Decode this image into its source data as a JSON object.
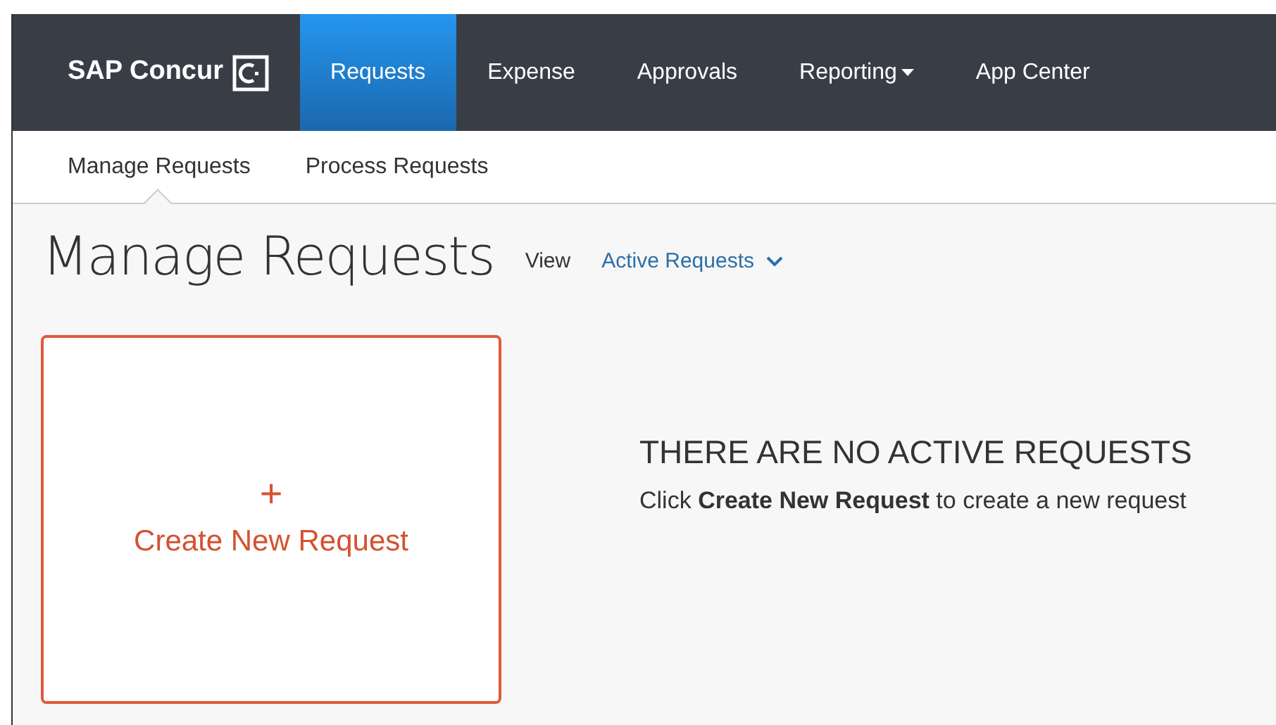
{
  "brand": {
    "name": "SAP Concur"
  },
  "nav": {
    "items": [
      {
        "label": "Requests",
        "selected": true,
        "has_menu": false
      },
      {
        "label": "Expense",
        "selected": false,
        "has_menu": false
      },
      {
        "label": "Approvals",
        "selected": false,
        "has_menu": false
      },
      {
        "label": "Reporting",
        "selected": false,
        "has_menu": true
      },
      {
        "label": "App Center",
        "selected": false,
        "has_menu": false
      }
    ]
  },
  "subnav": {
    "items": [
      {
        "label": "Manage Requests",
        "selected": true
      },
      {
        "label": "Process Requests",
        "selected": false
      }
    ]
  },
  "page": {
    "title": "Manage Requests",
    "view_label": "View",
    "view_value": "Active Requests"
  },
  "create_card": {
    "icon": "+",
    "label": "Create New Request"
  },
  "empty_state": {
    "title": "THERE ARE NO ACTIVE REQUESTS",
    "message": "Click **Create New Request** to create a new request"
  }
}
